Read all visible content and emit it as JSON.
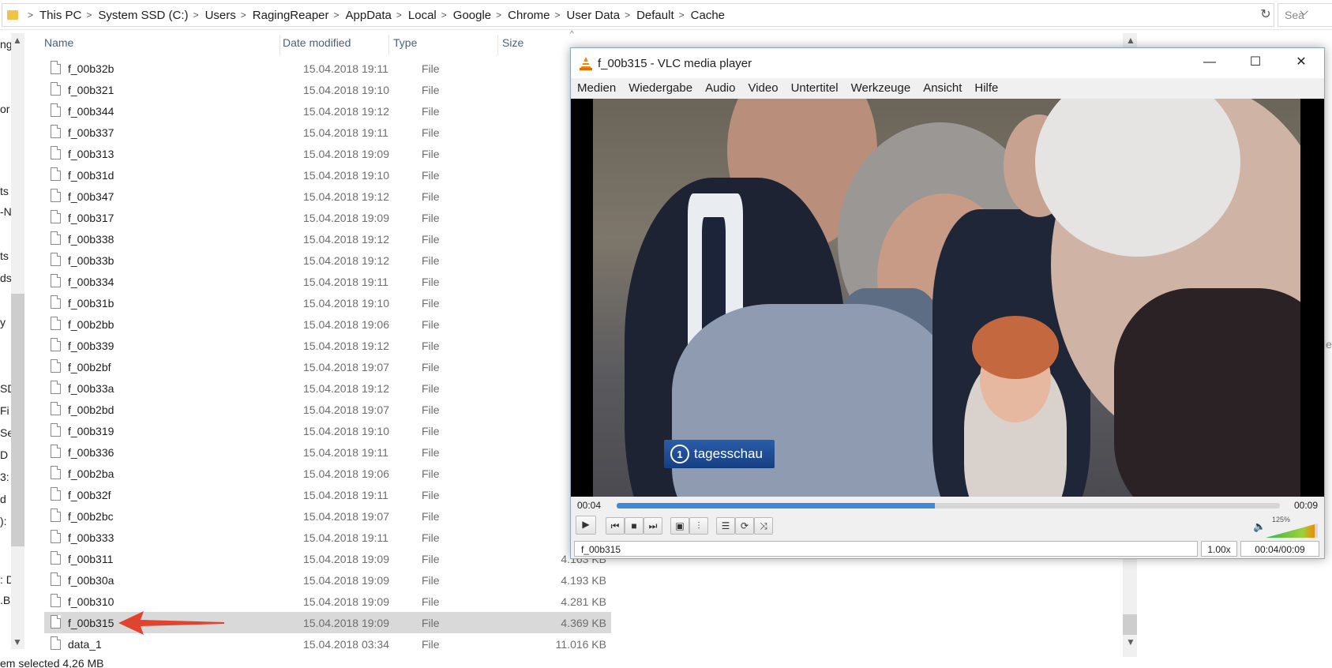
{
  "address_bar": {
    "crumbs": [
      "This PC",
      "System SSD (C:)",
      "Users",
      "RagingReaper",
      "AppData",
      "Local",
      "Google",
      "Chrome",
      "User Data",
      "Default",
      "Cache"
    ],
    "search_placeholder": "Sea"
  },
  "nav_fragments": [
    "ng",
    "or",
    "ts",
    "-N",
    "ts",
    "ds",
    "y",
    "SD",
    "Fi",
    "Se",
    "D",
    "3:",
    "d",
    "):",
    ": D",
    ".B"
  ],
  "columns": {
    "name": "Name",
    "date": "Date modified",
    "type": "Type",
    "size": "Size"
  },
  "files": [
    {
      "name": "f_00b32b",
      "date": "15.04.2018 19:11",
      "type": "File",
      "size": "3."
    },
    {
      "name": "f_00b321",
      "date": "15.04.2018 19:10",
      "type": "File",
      "size": "3."
    },
    {
      "name": "f_00b344",
      "date": "15.04.2018 19:12",
      "type": "File",
      "size": "3."
    },
    {
      "name": "f_00b337",
      "date": "15.04.2018 19:11",
      "type": "File",
      "size": "3."
    },
    {
      "name": "f_00b313",
      "date": "15.04.2018 19:09",
      "type": "File",
      "size": "3."
    },
    {
      "name": "f_00b31d",
      "date": "15.04.2018 19:10",
      "type": "File",
      "size": "3."
    },
    {
      "name": "f_00b347",
      "date": "15.04.2018 19:12",
      "type": "File",
      "size": "3."
    },
    {
      "name": "f_00b317",
      "date": "15.04.2018 19:09",
      "type": "File",
      "size": "3."
    },
    {
      "name": "f_00b338",
      "date": "15.04.2018 19:12",
      "type": "File",
      "size": "3."
    },
    {
      "name": "f_00b33b",
      "date": "15.04.2018 19:12",
      "type": "File",
      "size": "3."
    },
    {
      "name": "f_00b334",
      "date": "15.04.2018 19:11",
      "type": "File",
      "size": "3."
    },
    {
      "name": "f_00b31b",
      "date": "15.04.2018 19:10",
      "type": "File",
      "size": "3."
    },
    {
      "name": "f_00b2bb",
      "date": "15.04.2018 19:06",
      "type": "File",
      "size": "3."
    },
    {
      "name": "f_00b339",
      "date": "15.04.2018 19:12",
      "type": "File",
      "size": "3."
    },
    {
      "name": "f_00b2bf",
      "date": "15.04.2018 19:07",
      "type": "File",
      "size": "3."
    },
    {
      "name": "f_00b33a",
      "date": "15.04.2018 19:12",
      "type": "File",
      "size": "3."
    },
    {
      "name": "f_00b2bd",
      "date": "15.04.2018 19:07",
      "type": "File",
      "size": "3."
    },
    {
      "name": "f_00b319",
      "date": "15.04.2018 19:10",
      "type": "File",
      "size": "3."
    },
    {
      "name": "f_00b336",
      "date": "15.04.2018 19:11",
      "type": "File",
      "size": "3."
    },
    {
      "name": "f_00b2ba",
      "date": "15.04.2018 19:06",
      "type": "File",
      "size": "4."
    },
    {
      "name": "f_00b32f",
      "date": "15.04.2018 19:11",
      "type": "File",
      "size": "4."
    },
    {
      "name": "f_00b2bc",
      "date": "15.04.2018 19:07",
      "type": "File",
      "size": "4."
    },
    {
      "name": "f_00b333",
      "date": "15.04.2018 19:11",
      "type": "File",
      "size": "4."
    },
    {
      "name": "f_00b311",
      "date": "15.04.2018 19:09",
      "type": "File",
      "size": "4.163 KB"
    },
    {
      "name": "f_00b30a",
      "date": "15.04.2018 19:09",
      "type": "File",
      "size": "4.193 KB"
    },
    {
      "name": "f_00b310",
      "date": "15.04.2018 19:09",
      "type": "File",
      "size": "4.281 KB"
    },
    {
      "name": "f_00b315",
      "date": "15.04.2018 19:09",
      "type": "File",
      "size": "4.369 KB",
      "selected": true
    },
    {
      "name": "data_1",
      "date": "15.04.2018 03:34",
      "type": "File",
      "size": "11.016 KB"
    }
  ],
  "right_fragment": "le",
  "status_bar": "em selected  4,26 MB",
  "vlc": {
    "title": "f_00b315 - VLC media player",
    "menu": [
      "Medien",
      "Wiedergabe",
      "Audio",
      "Video",
      "Untertitel",
      "Werkzeuge",
      "Ansicht",
      "Hilfe"
    ],
    "overlay_logo": "tagesschau",
    "elapsed": "00:04",
    "total": "00:09",
    "progress_fraction": 0.48,
    "volume_label": "125%",
    "now_playing": "f_00b315",
    "speed": "1.00x",
    "time_display": "00:04/00:09",
    "accent": "#3f8ad6"
  }
}
